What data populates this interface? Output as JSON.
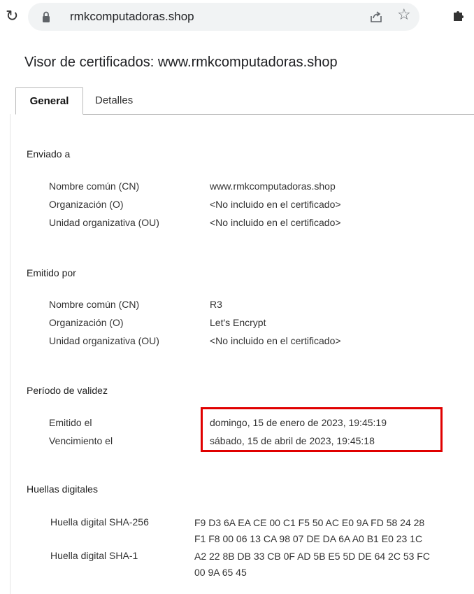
{
  "browser": {
    "url": "rmkcomputadoras.shop"
  },
  "viewer": {
    "title": "Visor de certificados: www.rmkcomputadoras.shop",
    "tabs": [
      {
        "label": "General",
        "active": true
      },
      {
        "label": "Detalles",
        "active": false
      }
    ]
  },
  "issued_to": {
    "heading": "Enviado a",
    "rows": [
      {
        "label": "Nombre común (CN)",
        "value": "www.rmkcomputadoras.shop"
      },
      {
        "label": "Organización (O)",
        "value": "<No incluido en el certificado>"
      },
      {
        "label": "Unidad organizativa (OU)",
        "value": "<No incluido en el certificado>"
      }
    ]
  },
  "issued_by": {
    "heading": "Emitido por",
    "rows": [
      {
        "label": "Nombre común (CN)",
        "value": "R3"
      },
      {
        "label": "Organización (O)",
        "value": "Let's Encrypt"
      },
      {
        "label": "Unidad organizativa (OU)",
        "value": "<No incluido en el certificado>"
      }
    ]
  },
  "validity": {
    "heading": "Período de validez",
    "rows": [
      {
        "label": "Emitido el",
        "value": "domingo, 15 de enero de 2023, 19:45:19"
      },
      {
        "label": "Vencimiento el",
        "value": "sábado, 15 de abril de 2023, 19:45:18"
      }
    ]
  },
  "fingerprints": {
    "heading": "Huellas digitales",
    "rows": [
      {
        "label": "Huella digital SHA-256",
        "line1": "F9 D3 6A EA CE 00 C1 F5 50 AC E0 9A FD 58 24 28",
        "line2": "F1 F8 00 06 13 CA 98 07 DE DA 6A A0 B1 E0 23 1C"
      },
      {
        "label": "Huella digital SHA-1",
        "line1": "A2 22 8B DB 33 CB 0F AD 5B E5 5D DE 64 2C 53 FC",
        "line2": "00 9A 65 45"
      }
    ]
  },
  "colors": {
    "highlight": "#e00000"
  },
  "icons": [
    "reload-icon",
    "lock-icon",
    "share-icon",
    "star-icon",
    "extensions-icon"
  ]
}
